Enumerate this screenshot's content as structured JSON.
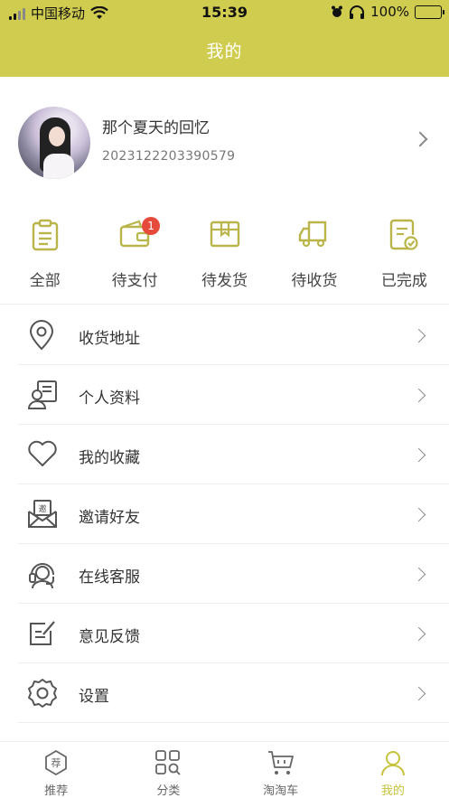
{
  "status_bar": {
    "carrier": "中国移动",
    "time": "15:39",
    "battery": "100%"
  },
  "nav": {
    "title": "我的"
  },
  "profile": {
    "name": "那个夏天的回忆",
    "id": "2023122203390579"
  },
  "orders": [
    {
      "label": "全部",
      "icon": "clipboard-icon"
    },
    {
      "label": "待支付",
      "icon": "wallet-icon",
      "badge": "1"
    },
    {
      "label": "待发货",
      "icon": "package-icon"
    },
    {
      "label": "待收货",
      "icon": "truck-icon"
    },
    {
      "label": "已完成",
      "icon": "document-check-icon"
    }
  ],
  "menu": [
    {
      "label": "收货地址",
      "icon": "location-pin-icon"
    },
    {
      "label": "个人资料",
      "icon": "profile-card-icon"
    },
    {
      "label": "我的收藏",
      "icon": "heart-icon"
    },
    {
      "label": "邀请好友",
      "icon": "invite-envelope-icon",
      "icon_text": "邀"
    },
    {
      "label": "在线客服",
      "icon": "headset-icon"
    },
    {
      "label": "意见反馈",
      "icon": "feedback-note-icon"
    },
    {
      "label": "设置",
      "icon": "gear-icon"
    }
  ],
  "tabs": [
    {
      "label": "推荐",
      "icon": "recommend-icon",
      "icon_text": "荐"
    },
    {
      "label": "分类",
      "icon": "category-grid-icon"
    },
    {
      "label": "淘淘车",
      "icon": "cart-icon"
    },
    {
      "label": "我的",
      "icon": "person-icon",
      "active": true
    }
  ],
  "colors": {
    "accent": "#cfcc4f",
    "icon_olive": "#b9b54a",
    "badge": "#e64a3b",
    "menu_icon": "#555555"
  }
}
